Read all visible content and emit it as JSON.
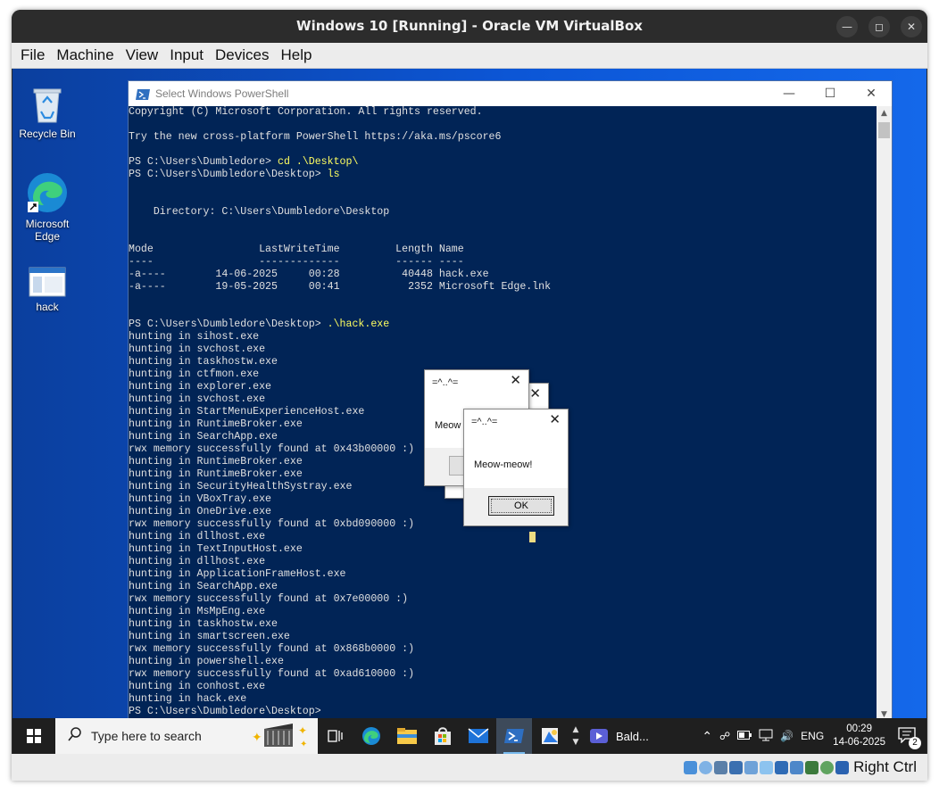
{
  "vbox": {
    "title": "Windows 10 [Running] - Oracle VM VirtualBox",
    "menu": [
      "File",
      "Machine",
      "View",
      "Input",
      "Devices",
      "Help"
    ],
    "host_key_label": "Right Ctrl",
    "status_icons": [
      "harddisk-icon",
      "optical-disk-icon",
      "audio-icon",
      "network-icon",
      "usb-icon",
      "shared-folder-icon",
      "display-icon",
      "recording-icon",
      "cpu-icon",
      "mouse-integration-icon",
      "keyboard-icon"
    ]
  },
  "desktop": {
    "icons": [
      {
        "label": "Recycle Bin",
        "icon": "recycle-bin-icon"
      },
      {
        "label": "Microsoft Edge",
        "icon": "edge-icon"
      },
      {
        "label": "hack",
        "icon": "exe-file-icon"
      }
    ]
  },
  "powershell": {
    "title": "Select Windows PowerShell",
    "lines": [
      {
        "t": "Copyright (C) Microsoft Corporation. All rights reserved."
      },
      {
        "t": ""
      },
      {
        "t": "Try the new cross-platform PowerShell https://aka.ms/pscore6"
      },
      {
        "t": ""
      },
      {
        "t": "PS C:\\Users\\Dumbledore> ",
        "c": "cd .\\Desktop\\"
      },
      {
        "t": "PS C:\\Users\\Dumbledore\\Desktop> ",
        "c": "ls"
      },
      {
        "t": ""
      },
      {
        "t": ""
      },
      {
        "t": "    Directory: C:\\Users\\Dumbledore\\Desktop"
      },
      {
        "t": ""
      },
      {
        "t": ""
      },
      {
        "t": "Mode                 LastWriteTime         Length Name"
      },
      {
        "t": "----                 -------------         ------ ----"
      },
      {
        "t": "-a----        14-06-2025     00:28          40448 hack.exe"
      },
      {
        "t": "-a----        19-05-2025     00:41           2352 Microsoft Edge.lnk"
      },
      {
        "t": ""
      },
      {
        "t": ""
      },
      {
        "t": "PS C:\\Users\\Dumbledore\\Desktop> ",
        "c": ".\\hack.exe"
      },
      {
        "t": "hunting in sihost.exe"
      },
      {
        "t": "hunting in svchost.exe"
      },
      {
        "t": "hunting in taskhostw.exe"
      },
      {
        "t": "hunting in ctfmon.exe"
      },
      {
        "t": "hunting in explorer.exe"
      },
      {
        "t": "hunting in svchost.exe"
      },
      {
        "t": "hunting in StartMenuExperienceHost.exe"
      },
      {
        "t": "hunting in RuntimeBroker.exe"
      },
      {
        "t": "hunting in SearchApp.exe"
      },
      {
        "t": "rwx memory successfully found at 0x43b00000 :)"
      },
      {
        "t": "hunting in RuntimeBroker.exe"
      },
      {
        "t": "hunting in RuntimeBroker.exe"
      },
      {
        "t": "hunting in SecurityHealthSystray.exe"
      },
      {
        "t": "hunting in VBoxTray.exe"
      },
      {
        "t": "hunting in OneDrive.exe"
      },
      {
        "t": "rwx memory successfully found at 0xbd090000 :)"
      },
      {
        "t": "hunting in dllhost.exe"
      },
      {
        "t": "hunting in TextInputHost.exe"
      },
      {
        "t": "hunting in dllhost.exe"
      },
      {
        "t": "hunting in ApplicationFrameHost.exe"
      },
      {
        "t": "hunting in SearchApp.exe"
      },
      {
        "t": "rwx memory successfully found at 0x7e00000 :)"
      },
      {
        "t": "hunting in MsMpEng.exe"
      },
      {
        "t": "hunting in taskhostw.exe"
      },
      {
        "t": "hunting in smartscreen.exe"
      },
      {
        "t": "rwx memory successfully found at 0x868b0000 :)"
      },
      {
        "t": "hunting in powershell.exe"
      },
      {
        "t": "rwx memory successfully found at 0xad610000 :)"
      },
      {
        "t": "hunting in conhost.exe"
      },
      {
        "t": "hunting in hack.exe"
      },
      {
        "t": "PS C:\\Users\\Dumbledore\\Desktop>"
      }
    ]
  },
  "msgboxes": [
    {
      "title": "=^..^=",
      "text": "Meow",
      "ok": ""
    },
    {
      "title": "=^..^=",
      "text": "Meow-meow!",
      "ok": "OK"
    }
  ],
  "taskbar": {
    "search_placeholder": "Type here to search",
    "running_app": "Bald...",
    "language": "ENG",
    "time": "00:29",
    "date": "14-06-2025",
    "notification_count": "2",
    "pinned": [
      "task-view-icon",
      "edge-icon",
      "file-explorer-icon",
      "store-icon",
      "mail-icon",
      "powershell-icon",
      "paint-icon"
    ]
  }
}
